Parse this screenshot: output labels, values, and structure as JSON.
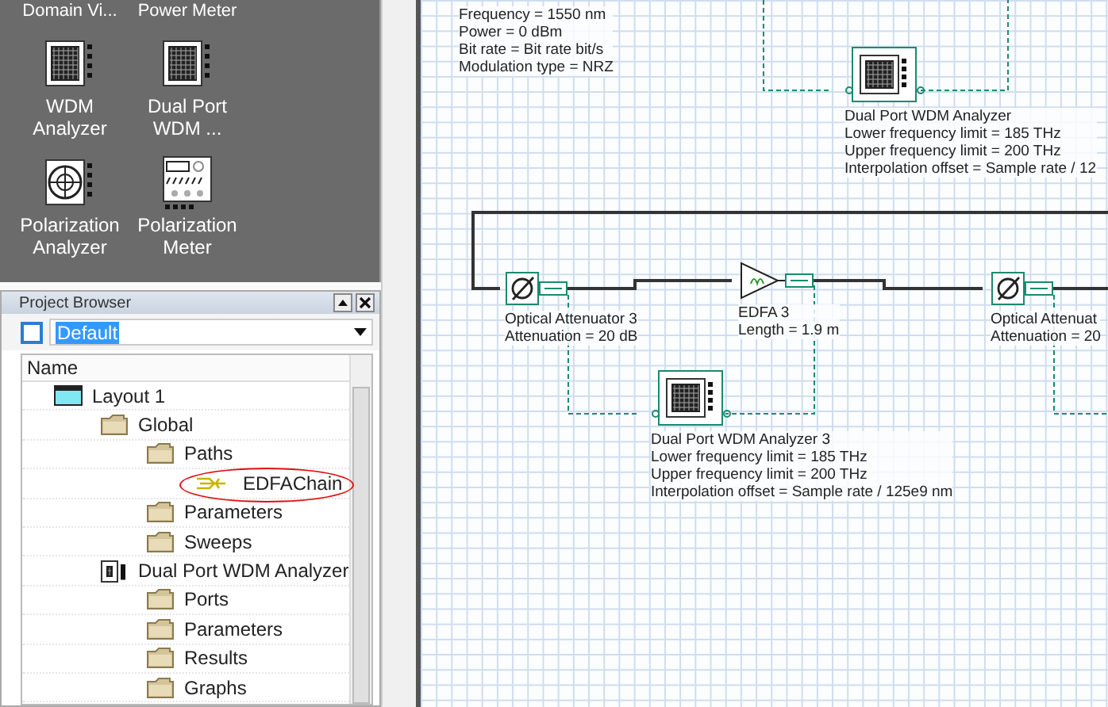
{
  "library": {
    "items": [
      {
        "label": "Domain Vi...",
        "kind": "cut"
      },
      {
        "label": "Power Meter",
        "kind": "cut"
      },
      {
        "label": "WDM Analyzer",
        "kind": "analyzer"
      },
      {
        "label": "Dual Port WDM ...",
        "kind": "analyzer"
      },
      {
        "label": "Polarization Analyzer",
        "kind": "polarization-analyzer"
      },
      {
        "label": "Polarization Meter",
        "kind": "polarization-meter"
      }
    ]
  },
  "project_browser": {
    "title": "Project Browser",
    "layout_select": {
      "value": "Default"
    },
    "column": "Name",
    "tree": [
      {
        "label": "Layout 1",
        "kind": "layout",
        "children": [
          {
            "label": "Global",
            "kind": "folder",
            "children": [
              {
                "label": "Paths",
                "kind": "folder",
                "children": [
                  {
                    "label": "EDFAChain",
                    "kind": "path",
                    "circled": true
                  }
                ]
              },
              {
                "label": "Parameters",
                "kind": "folder"
              },
              {
                "label": "Sweeps",
                "kind": "folder"
              }
            ]
          },
          {
            "label": "Dual Port WDM Analyzer",
            "kind": "component",
            "children": [
              {
                "label": "Ports",
                "kind": "folder"
              },
              {
                "label": "Parameters",
                "kind": "folder"
              },
              {
                "label": "Results",
                "kind": "folder"
              },
              {
                "label": "Graphs",
                "kind": "folder"
              }
            ]
          }
        ]
      }
    ]
  },
  "canvas": {
    "source_label": [
      "Frequency = 1550  nm",
      "Power = 0  dBm",
      "Bit rate = Bit rate  bit/s",
      "Modulation type = NRZ"
    ],
    "components": [
      {
        "kind": "analyzer",
        "label": [
          "Dual Port WDM Analyzer",
          "Lower frequency limit = 185  THz",
          "Upper frequency limit = 200  THz",
          "Interpolation offset = Sample rate / 12"
        ]
      },
      {
        "kind": "attenuator",
        "label": [
          "Optical Attenuator  3",
          "Attenuation = 20  dB"
        ]
      },
      {
        "kind": "edfa",
        "label": [
          "EDFA  3",
          "Length = 1.9  m"
        ]
      },
      {
        "kind": "attenuator",
        "label": [
          "Optical Attenuat",
          "Attenuation = 20"
        ]
      },
      {
        "kind": "analyzer",
        "label": [
          "Dual Port WDM Analyzer  3",
          "Lower frequency limit = 185  THz",
          "Upper frequency limit = 200  THz",
          "Interpolation offset = Sample rate / 125e9  nm"
        ]
      }
    ]
  }
}
